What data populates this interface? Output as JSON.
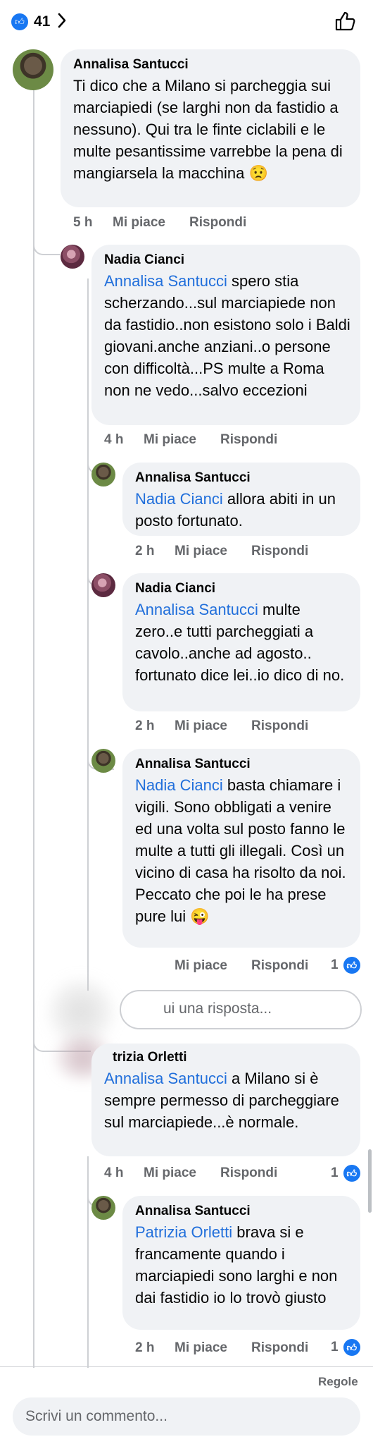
{
  "header": {
    "like_count": "41",
    "chevron_icon": "chevron-right-icon",
    "thumb_icon": "thumbs-up-outline-icon"
  },
  "comments": [
    {
      "author": "Annalisa Santucci",
      "text": "Ti dico che a Milano si parcheggia sui marciapiedi (se larghi non da fastidio a nessuno). Qui tra le finte ciclabili e le multe pesantissime varrebbe la pena di mangiarsela la macchina 😟",
      "time": "5 h",
      "like": "Mi piace",
      "reply": "Rispondi"
    },
    {
      "author": "Nadia Cianci",
      "mention": "Annalisa Santucci",
      "text": " spero stia scherzando...sul marciapiede non da fastidio..non esistono solo i Baldi giovani.anche anziani..o persone con difficoltà...PS multe a Roma non ne vedo...salvo eccezioni",
      "time": "4 h",
      "like": "Mi piace",
      "reply": "Rispondi"
    },
    {
      "author": "Annalisa Santucci",
      "mention": "Nadia Cianci",
      "text": " allora abiti in un posto fortunato.",
      "time": "2 h",
      "like": "Mi piace",
      "reply": "Rispondi"
    },
    {
      "author": "Nadia Cianci",
      "mention": "Annalisa Santucci",
      "text": " multe zero..e tutti parcheggiati a cavolo..anche ad agosto.. fortunato dice lei..io dico di no.",
      "time": "2 h",
      "like": "Mi piace",
      "reply": "Rispondi"
    },
    {
      "author": "Annalisa Santucci",
      "mention": "Nadia Cianci",
      "text": " basta chiamare i vigili. Sono obbligati a venire ed una volta sul posto fanno le multe a tutti gli illegali. Così un vicino di casa ha risolto da noi. Peccato che poi le ha prese pure lui 😜",
      "like": "Mi piace",
      "reply": "Rispondi",
      "reactions": "1"
    },
    {
      "author": "trizia Orletti",
      "mention": "Annalisa Santucci",
      "text": " a Milano si è sempre permesso di parcheggiare sul marciapiede...è normale.",
      "time": "4 h",
      "like": "Mi piace",
      "reply": "Rispondi",
      "reactions": "1"
    },
    {
      "author": "Annalisa Santucci",
      "mention": "Patrizia Orletti",
      "text": " brava si e francamente quando i marciapiedi sono larghi e non dai fastidio io lo trovò giusto",
      "time": "2 h",
      "like": "Mi piace",
      "reply": "Rispondi",
      "reactions": "1"
    }
  ],
  "reply_box": {
    "placeholder": "ui una risposta..."
  },
  "footer": {
    "rules_label": "Regole",
    "comment_placeholder": "Scrivi un commento..."
  },
  "colors": {
    "mention": "#216fdb",
    "like_badge": "#1877f2",
    "bubble": "#f0f2f5",
    "meta": "#65676b"
  }
}
